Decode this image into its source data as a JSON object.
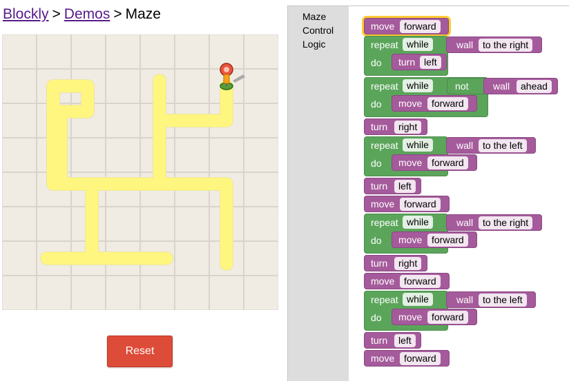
{
  "breadcrumb": {
    "blockly": "Blockly",
    "demos": "Demos",
    "current": "Maze",
    "separator": ">"
  },
  "reset_label": "Reset",
  "toolbox": {
    "categories": [
      "Maze",
      "Control",
      "Logic"
    ]
  },
  "words": {
    "move": "move",
    "turn": "turn",
    "repeat": "repeat",
    "do": "do",
    "wall": "wall",
    "not": "not"
  },
  "options": {
    "forward": "forward",
    "left": "left",
    "right": "right",
    "while": "while",
    "to_the_right": "to the right",
    "to_the_left": "to the left",
    "ahead": "ahead"
  },
  "colors": {
    "action_block": "#a55b9b",
    "control_block": "#5ba55b",
    "selection": "#ffcc33",
    "reset_button": "#dd4b39",
    "path": "#fff67f",
    "maze_background": "#f0ece4"
  }
}
